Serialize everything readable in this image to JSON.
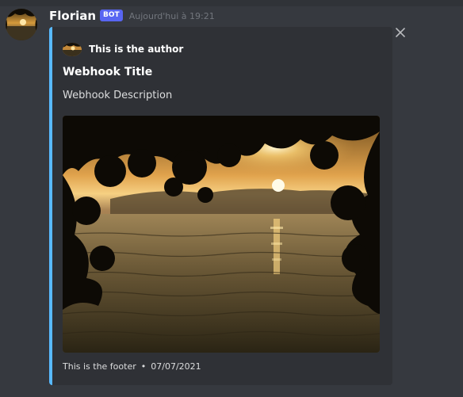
{
  "message": {
    "username": "Florian",
    "badge": "BOT",
    "timestamp": "Aujourd'hui à 19:21"
  },
  "embed": {
    "accent_color": "#58b9ff",
    "author_name": "This is the author",
    "title": "Webhook Title",
    "description": "Webhook Description",
    "footer_text": "This is the footer",
    "footer_separator": "•",
    "footer_date": "07/07/2021"
  },
  "icons": {
    "close": "close-icon"
  },
  "colors": {
    "background": "#36393f",
    "embed_background": "#2f3136",
    "bot_badge": "#5865f2"
  }
}
